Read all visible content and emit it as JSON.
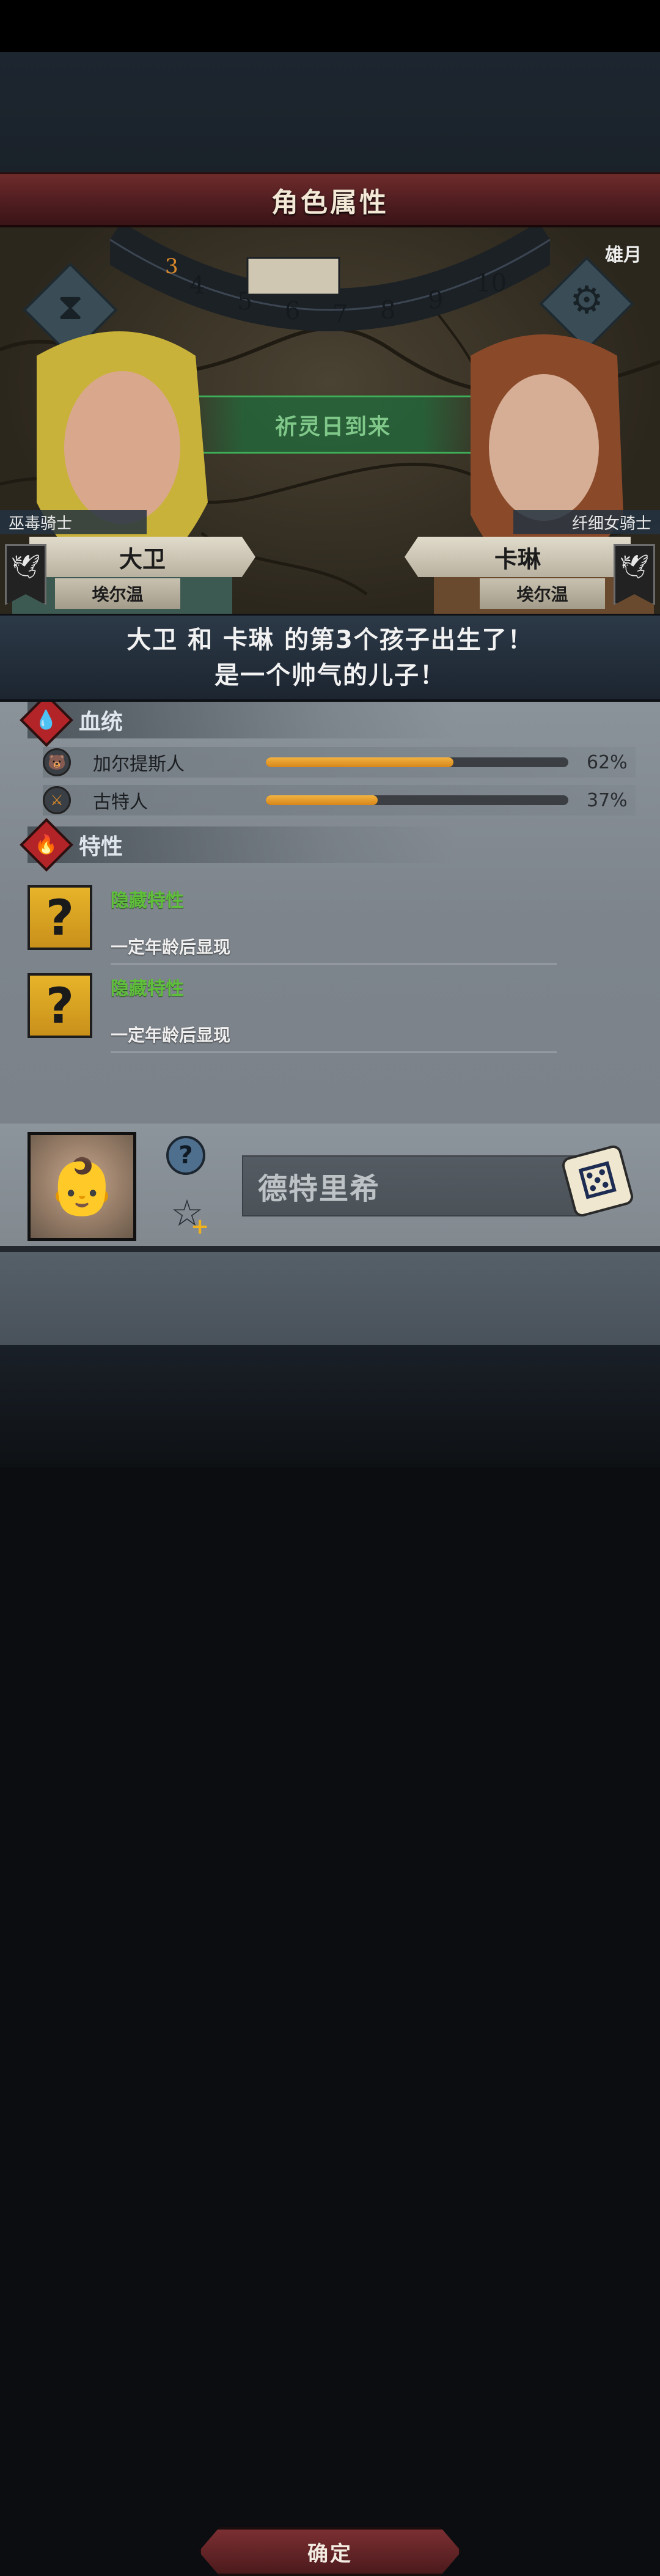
{
  "title": "角色属性",
  "scene": {
    "month_label": "雄月",
    "event_text": "祈灵日到来",
    "calendar_highlight": "3",
    "calendar_numbers": [
      "4",
      "5",
      "6",
      "7",
      "8",
      "9",
      "10"
    ]
  },
  "father": {
    "title": "巫毒骑士",
    "name": "大卫",
    "house": "埃尔温"
  },
  "mother": {
    "title": "纤细女骑士",
    "name": "卡琳",
    "house": "埃尔温"
  },
  "announcement": {
    "line1": "大卫 和 卡琳 的第3个孩子出生了！",
    "line2": "是一个帅气的儿子！"
  },
  "bloodline": {
    "label": "血统",
    "rows": [
      {
        "name": "加尔提斯人",
        "pct_text": "62%",
        "value": 62
      },
      {
        "name": "古特人",
        "pct_text": "37%",
        "value": 37
      }
    ]
  },
  "traits": {
    "label": "特性",
    "items": [
      {
        "title": "隐藏特性",
        "desc": "一定年龄后显现"
      },
      {
        "title": "隐藏特性",
        "desc": "一定年龄后显现"
      }
    ]
  },
  "child": {
    "name_value": "德特里希"
  },
  "footer": {
    "confirm_label": "确定"
  },
  "colors": {
    "accent_red": "#b22428",
    "bar_fill": "#e09a24",
    "trait_green": "#5fbf3b"
  }
}
